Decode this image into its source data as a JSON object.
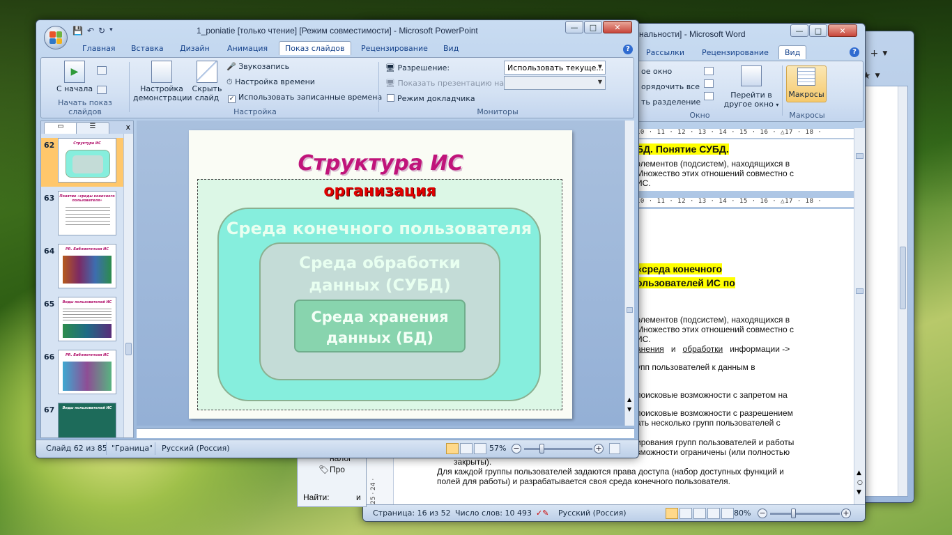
{
  "colors": {
    "slide_title": "#c0147a",
    "org_label": "#e00000",
    "layer1_fill": "#86eedd",
    "layer2_fill": "#c4dcd7",
    "layer3_fill": "#88d4ae",
    "highlight": "#ffff00",
    "selected_thumb": "#ffc76b"
  },
  "bg_window": {
    "toolbar_icons": [
      "plus-icon",
      "star-icon",
      "chevron-down-icon"
    ]
  },
  "word": {
    "title": "нальности] - Microsoft Word",
    "tabs": [
      "Рассылки",
      "Рецензирование",
      "Вид"
    ],
    "active_tab": "Вид",
    "ribbon": {
      "window_items": [
        "ое окно",
        "орядочить все",
        "ть разделение"
      ],
      "switch_windows": "Перейти в другое окно",
      "macros": "Макросы",
      "group_window": "Окно",
      "group_macros": "Макросы"
    },
    "ruler_top": "10 · 11 · 12 · 13 · 14 · 15 · 16 · △17 · 18 ·",
    "ruler_mid": "10 · 11 · 12 · 13 · 14 · 15 · 16 · △17 · 18 ·",
    "doc": {
      "heading1": "БД. Понятие СУБД.",
      "p1_l1": "элементов (подсистем), находящихся в",
      "p1_l2": "Множество этих отношений совместно с",
      "p1_l3": "ИС.",
      "heading2_l1": "«среда конечного",
      "heading2_l2": "ользователей ИС по",
      "p2_l1": "элементов (подсистем), находящихся в",
      "p2_l2": "Множество этих отношений совместно с",
      "p2_l3": "ИС.",
      "p3_a": "анения",
      "p3_b": "и",
      "p3_c": "обработки",
      "p3_d": "информации ->",
      "p4": "упп пользователей к данным в",
      "p5": "поисковые возможности с запретом на",
      "p6_l1": "поисковые возможности с разрешением",
      "p6_l2": "ать несколько групп пользователей с",
      "p7_l1": "ирования групп пользователей и работы",
      "p7_l2": "зможности ограничены (или полностью",
      "p7_l3": "закрыты).",
      "p8_l1": "Для каждой группы пользователей задаются права доступа (набор доступных функций и",
      "p8_l2": "полей для работы) и разрабатывается своя среда конечного пользователя.",
      "nalog": "налог",
      "pro": "Про"
    },
    "status": {
      "page": "Страница: 16 из 52",
      "words": "Число слов: 10 493",
      "lang": "Русский (Россия)",
      "zoom": "80%"
    },
    "left_ruler": "25 · 24 ·"
  },
  "nav_strip": {
    "find_label": "Найти:",
    "find_value": "и"
  },
  "ppt": {
    "title": "1_poniatie [только чтение] [Режим совместимости] - Microsoft PowerPoint",
    "tabs": [
      "Главная",
      "Вставка",
      "Дизайн",
      "Анимация",
      "Показ слайдов",
      "Рецензирование",
      "Вид"
    ],
    "active_tab": "Показ слайдов",
    "ribbon": {
      "from_start": "С начала",
      "group_start": "Начать показ слайдов",
      "setup_show": "Настройка демонстрации",
      "hide_slide": "Скрыть слайд",
      "record_narration": "Звукозапись",
      "rehearse": "Настройка времени",
      "use_timings": "Использовать записанные времена",
      "group_setup": "Настройка",
      "resolution_label": "Разрешение:",
      "resolution_value": "Использовать текуще...",
      "show_on_label": "Показать презентацию на:",
      "presenter_view": "Режим докладчика",
      "group_monitors": "Мониторы"
    },
    "panel": {
      "close": "x",
      "thumbnails": [
        {
          "num": "62",
          "title": "Структура ИС",
          "selected": true
        },
        {
          "num": "63",
          "title": "Понятие «среды конечного пользователя»",
          "selected": false
        },
        {
          "num": "64",
          "title": "PR. Библиотечная ИС",
          "selected": false
        },
        {
          "num": "65",
          "title": "Виды пользователей ИС",
          "selected": false
        },
        {
          "num": "66",
          "title": "PR. Библиотечная ИС",
          "selected": false
        },
        {
          "num": "67",
          "title": "Виды пользователей ИС",
          "selected": false
        }
      ]
    },
    "slide": {
      "title": "Структура ИС",
      "org": "организация",
      "layer1": "Среда конечного пользователя",
      "layer2_l1": "Среда обработки",
      "layer2_l2": "данных (СУБД)",
      "layer3_l1": "Среда хранения",
      "layer3_l2": "данных (БД)"
    },
    "status": {
      "slide": "Слайд 62 из 85",
      "theme": "\"Граница\"",
      "lang": "Русский (Россия)",
      "zoom": "57%"
    }
  }
}
